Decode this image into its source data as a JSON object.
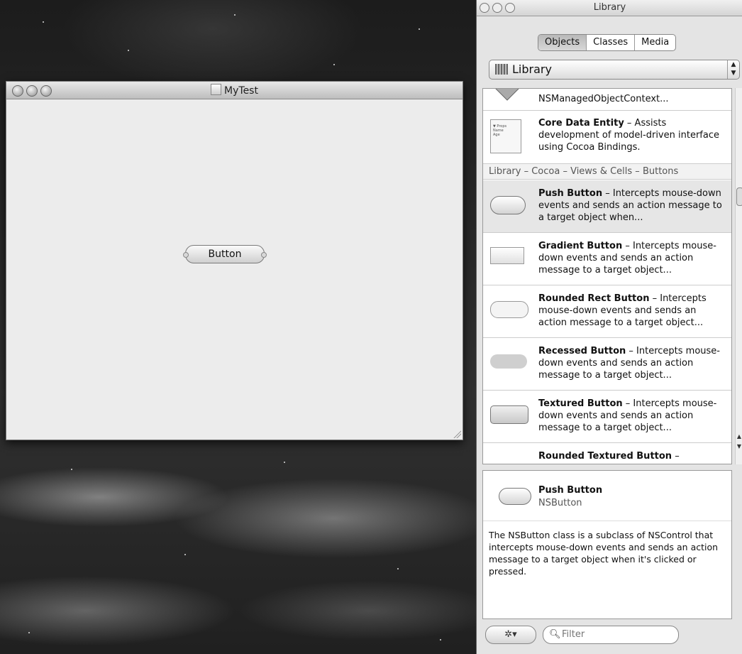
{
  "mytest_window": {
    "title": "MyTest",
    "button_label": "Button"
  },
  "library": {
    "title": "Library",
    "tabs": [
      {
        "label": "Objects",
        "selected": true
      },
      {
        "label": "Classes",
        "selected": false
      },
      {
        "label": "Media",
        "selected": false
      }
    ],
    "popup_value": "Library",
    "items_top": [
      {
        "title": "",
        "desc": "NSManagedObjectContext..."
      },
      {
        "title": "Core Data Entity",
        "desc": " – Assists development of model-driven interface using Cocoa Bindings.",
        "thumb_lines": [
          "▼ Props",
          "Name",
          "Age"
        ]
      }
    ],
    "group_header": "Library – Cocoa – Views & Cells – Buttons",
    "items": [
      {
        "title": "Push Button",
        "desc": " – Intercepts mouse-down events and sends an action message to a target object when..."
      },
      {
        "title": "Gradient Button",
        "desc": " – Intercepts mouse-down events and sends an action message to a target object..."
      },
      {
        "title": "Rounded Rect Button",
        "desc": " – Intercepts mouse-down events and sends an action message to a target object..."
      },
      {
        "title": "Recessed Button",
        "desc": " – Intercepts mouse-down events and sends an action message to a target object..."
      },
      {
        "title": "Textured Button",
        "desc": " – Intercepts mouse-down events and sends an action message to a target object..."
      },
      {
        "title": "Rounded Textured Button",
        "desc": " –"
      }
    ],
    "detail": {
      "title": "Push Button",
      "class_name": "NSButton",
      "description": "The NSButton class is a subclass of NSControl that intercepts mouse-down events and sends an action message to a target object when it's clicked or pressed."
    },
    "gear_label": "✲▾",
    "filter_placeholder": "Filter"
  }
}
